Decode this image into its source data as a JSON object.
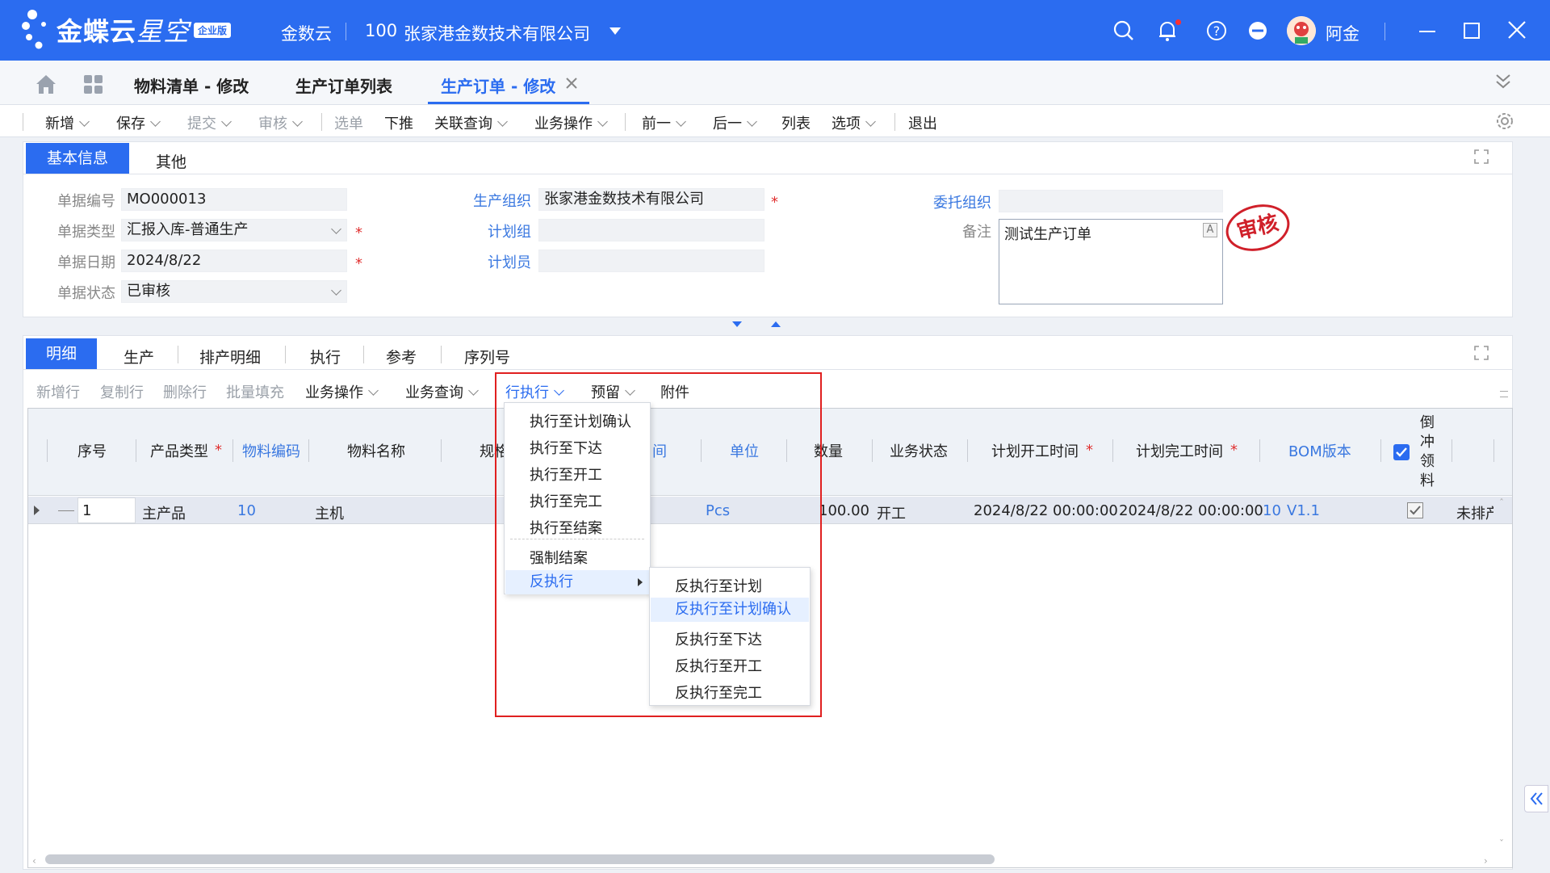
{
  "header": {
    "logo_main": "金蝶云",
    "logo_sub": "星空",
    "edition_badge": "企业版",
    "tenant": "金数云",
    "org_code": "100",
    "org_name": "张家港金数技术有限公司",
    "user_name": "阿金",
    "icons": [
      "search-icon",
      "bell-icon",
      "help-icon",
      "more-icon",
      "avatar",
      "minimize-icon",
      "maximize-icon",
      "close-icon"
    ]
  },
  "page_tabs": [
    {
      "label": "物料清单 - 修改"
    },
    {
      "label": "生产订单列表"
    },
    {
      "label": "生产订单 - 修改",
      "active": true
    }
  ],
  "toolbar": {
    "new": "新增",
    "save": "保存",
    "submit": "提交",
    "audit": "审核",
    "select": "选单",
    "push": "下推",
    "related": "关联查询",
    "business": "业务操作",
    "prev": "前一",
    "next": "后一",
    "list": "列表",
    "options": "选项",
    "exit": "退出"
  },
  "basic": {
    "tabs": [
      "基本信息",
      "其他"
    ],
    "bill_no_label": "单据编号",
    "bill_no": "MO000013",
    "bill_type_label": "单据类型",
    "bill_type": "汇报入库-普通生产",
    "bill_date_label": "单据日期",
    "bill_date": "2024/8/22",
    "bill_status_label": "单据状态",
    "bill_status": "已审核",
    "prd_org_label": "生产组织",
    "prd_org": "张家港金数技术有限公司",
    "plan_group_label": "计划组",
    "plan_group": "",
    "planner_label": "计划员",
    "planner": "",
    "entrust_org_label": "委托组织",
    "entrust_org": "",
    "remark_label": "备注",
    "remark": "测试生产订单",
    "stamp": "审核"
  },
  "detail": {
    "tabs": [
      "明细",
      "生产",
      "排产明细",
      "执行",
      "参考",
      "序列号"
    ],
    "toolbar": {
      "add_row": "新增行",
      "copy_row": "复制行",
      "del_row": "删除行",
      "batch_fill": "批量填充",
      "business": "业务操作",
      "query": "业务查询",
      "row_exec": "行执行",
      "reserve": "预留",
      "attach": "附件"
    },
    "columns": {
      "seq": "序号",
      "prod_type": "产品类型",
      "mat_code": "物料编码",
      "mat_name": "物料名称",
      "spec": "规格",
      "time_part": "间",
      "unit": "单位",
      "qty": "数量",
      "biz_status": "业务状态",
      "plan_start": "计划开工时间",
      "plan_finish": "计划完工时间",
      "bom": "BOM版本",
      "backflush": [
        "倒",
        "冲",
        "领",
        "料"
      ]
    },
    "row": {
      "seq": "1",
      "prod_type": "主产品",
      "mat_code": "10",
      "mat_name": "主机",
      "unit": "Pcs",
      "qty": "100.00",
      "biz_status": "开工",
      "plan_start": "2024/8/22 00:00:00",
      "plan_finish": "2024/8/22 00:00:00",
      "bom_code": "10",
      "bom_version": "V1.1",
      "last": "未排产"
    }
  },
  "row_exec_menu": [
    "执行至计划确认",
    "执行至下达",
    "执行至开工",
    "执行至完工",
    "执行至结案",
    "强制结案",
    "反执行"
  ],
  "reverse_menu": [
    "反执行至计划",
    "反执行至计划确认",
    "反执行至下达",
    "反执行至开工",
    "反执行至完工"
  ],
  "colors": {
    "brand": "#2b6cf0",
    "highlight_box": "#e02020",
    "stamp": "#d0202a"
  }
}
